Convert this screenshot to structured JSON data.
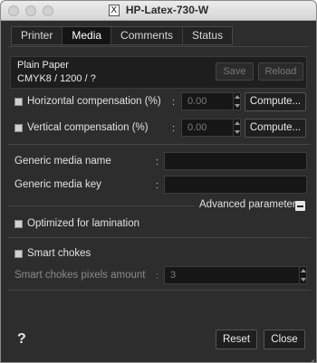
{
  "window": {
    "title": "HP-Latex-730-W",
    "app_icon": "X"
  },
  "tabs": [
    {
      "label": "Printer"
    },
    {
      "label": "Media",
      "active": true
    },
    {
      "label": "Comments"
    },
    {
      "label": "Status"
    }
  ],
  "media": {
    "name": "Plain Paper",
    "spec": "CMYK8 / 1200 / ?"
  },
  "media_actions": {
    "save": "Save",
    "reload": "Reload"
  },
  "horizontal": {
    "label": "Horizontal compensation (%)",
    "colon": ":",
    "value": "0.00",
    "compute": "Compute..."
  },
  "vertical": {
    "label": "Vertical compensation (%)",
    "colon": ":",
    "value": "0.00",
    "compute": "Compute..."
  },
  "generic_name": {
    "label": "Generic media name",
    "colon": ":",
    "value": ""
  },
  "generic_key": {
    "label": "Generic media key",
    "colon": ":",
    "value": ""
  },
  "advanced": {
    "label": "Advanced parameters"
  },
  "lamination": {
    "label": "Optimized for lamination"
  },
  "smart_chokes": {
    "label": "Smart chokes"
  },
  "smart_chokes_pixels": {
    "label": "Smart chokes pixels amount",
    "colon": ":",
    "value": "3"
  },
  "footer": {
    "help": "?",
    "reset": "Reset",
    "close": "Close"
  }
}
